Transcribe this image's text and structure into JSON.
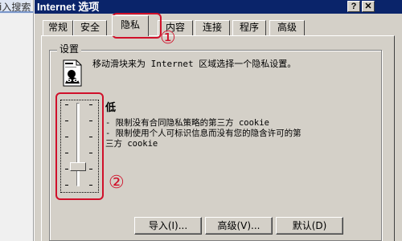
{
  "background_window": {
    "partial_text": "i入搜索"
  },
  "window": {
    "title": "Internet 选项",
    "help_glyph": "?",
    "close_glyph": "✕"
  },
  "tabs": [
    {
      "label": "常规"
    },
    {
      "label": "安全"
    },
    {
      "label": "隐私",
      "active": true
    },
    {
      "label": "内容"
    },
    {
      "label": "连接"
    },
    {
      "label": "程序"
    },
    {
      "label": "高级"
    }
  ],
  "annotations": {
    "marker_1": "①",
    "marker_2": "②",
    "color": "#d0102a"
  },
  "settings": {
    "group_label": "设置",
    "intro": "移动滑块来为 Internet 区域选择一个隐私设置。",
    "level_name": "低",
    "description_1": "- 限制没有合同隐私策略的第三方 cookie",
    "description_2": "- 限制使用个人可标识信息而没有您的隐含许可的第\n三方 cookie",
    "slider": {
      "positions": 6,
      "selected_index": 1,
      "selected_level": "低"
    }
  },
  "buttons": {
    "import": "导入(I)...",
    "advanced": "高级(V)...",
    "default": "默认(D)"
  },
  "colors": {
    "dialog_bg": "#d4d0c8",
    "titlebar": "#0a246a",
    "annotation_red": "#d0102a"
  }
}
